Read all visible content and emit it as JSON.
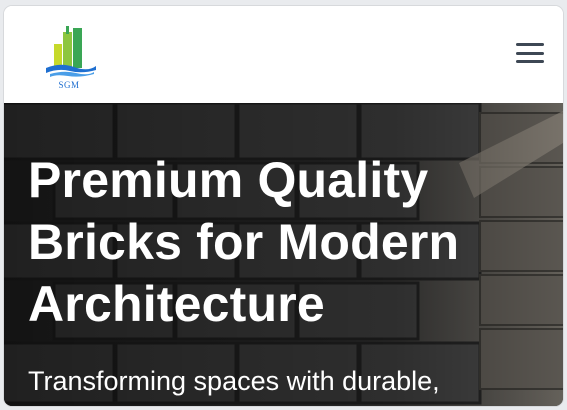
{
  "header": {
    "logo": {
      "text": "SGM",
      "icon": "building-logo-icon"
    },
    "menu": {
      "icon": "hamburger-menu-icon"
    }
  },
  "hero": {
    "title": "Premium Quality Bricks for Modern Architecture",
    "subtitle": "Transforming spaces with durable,"
  },
  "colors": {
    "logo_green": "#8dc63f",
    "logo_blue": "#1f6fd0",
    "menu_icon": "#3d4754",
    "hero_text": "#ffffff"
  }
}
